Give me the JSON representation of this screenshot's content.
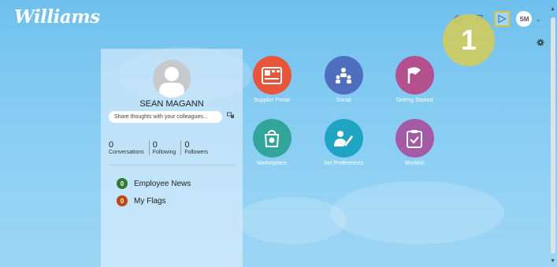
{
  "header": {
    "logo": "Williams",
    "avatar_initials": "SM",
    "chevron": "⌄"
  },
  "annotation": {
    "step_number": "1"
  },
  "profile": {
    "name": "SEAN MAGANN",
    "share_placeholder": "Share thoughts with your colleagues...",
    "stats": [
      {
        "value": "0",
        "label": "Conversations"
      },
      {
        "value": "0",
        "label": "Following"
      },
      {
        "value": "0",
        "label": "Followers"
      }
    ]
  },
  "notifications": [
    {
      "count": "0",
      "label": "Employee News",
      "color": "#2e7d32"
    },
    {
      "count": "0",
      "label": "My Flags",
      "color": "#c0460f"
    }
  ],
  "apps": [
    {
      "label": "Supplier Portal",
      "color": "#e8553a",
      "icon": "supplier-portal-icon"
    },
    {
      "label": "Social",
      "color": "#4f6ebd",
      "icon": "social-icon"
    },
    {
      "label": "Getting Started",
      "color": "#b5508f",
      "icon": "getting-started-flag-icon"
    },
    {
      "label": "Marketplace",
      "color": "#31a59a",
      "icon": "marketplace-bag-icon"
    },
    {
      "label": "Set Preferences",
      "color": "#1fa4c4",
      "icon": "set-preferences-icon"
    },
    {
      "label": "Worklist",
      "color": "#a55aa5",
      "icon": "worklist-clipboard-icon"
    }
  ]
}
